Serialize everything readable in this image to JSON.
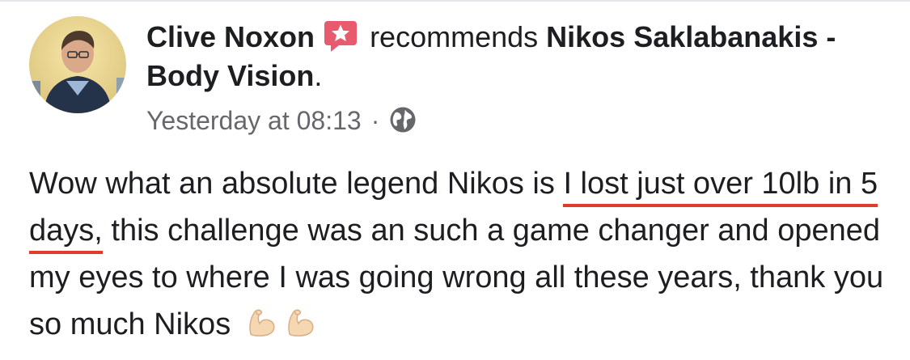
{
  "post": {
    "author": "Clive Noxon",
    "action": "recommends",
    "page_name": "Nikos Saklabanakis - Body Vision",
    "period": ".",
    "timestamp": "Yesterday at 08:13",
    "separator": "·",
    "icons": {
      "recommend_badge": "recommend-star-icon",
      "audience": "globe-icon",
      "emoji": "flexed-biceps-emoji"
    },
    "text": {
      "part1": "Wow what an absolute legend Nikos is ",
      "highlight": "I lost just over 10lb in 5 days,",
      "part2": " this challenge was an such a game changer and opened my eyes to where I was going wrong all these years, thank you so much Nikos"
    }
  },
  "colors": {
    "text": "#1c1e21",
    "meta": "#65676b",
    "underline": "#e03c2c",
    "badge": "#e85a6e"
  }
}
